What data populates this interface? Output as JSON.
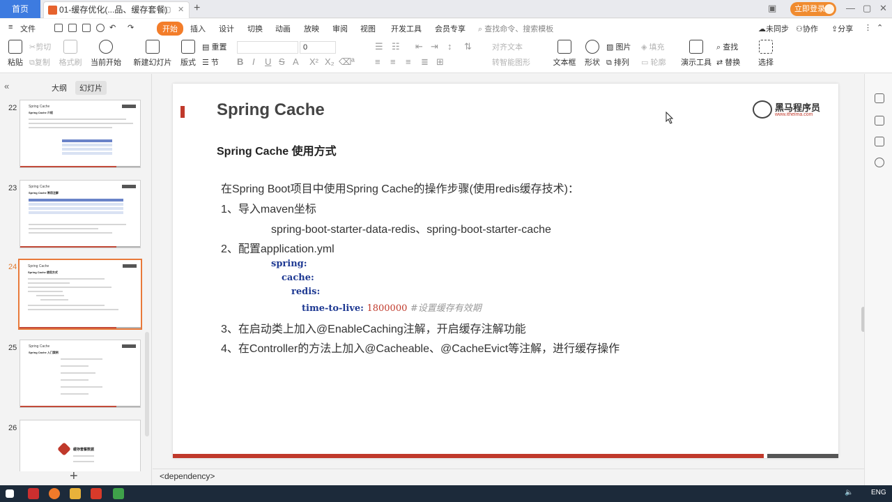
{
  "titlebar": {
    "home_tab": "首页",
    "doc_tab": "01-缓存优化(...品、缓存套餐)",
    "login": "立即登录"
  },
  "menu": {
    "file": "文件",
    "items": [
      "开始",
      "插入",
      "设计",
      "切换",
      "动画",
      "放映",
      "审阅",
      "视图",
      "开发工具",
      "会员专享"
    ],
    "search": "查找命令、搜索模板",
    "right": [
      "未同步",
      "协作",
      "分享"
    ]
  },
  "ribbon": {
    "paste": "粘贴",
    "cut": "剪切",
    "copy": "复制",
    "format_painter": "格式刷",
    "start_current": "当前开始",
    "new_slide": "新建幻灯片",
    "layout": "版式",
    "reset": "重置",
    "section": "节",
    "font_size": "0",
    "text_box": "文本框",
    "shape": "形状",
    "picture": "图片",
    "fill": "填充",
    "arrange": "排列",
    "outline": "轮廓",
    "find": "查找",
    "replace": "替换",
    "present_tools": "演示工具",
    "select": "选择",
    "align_text": "对齐文本",
    "smart_convert": "转智能图形"
  },
  "left_panel": {
    "tabs": [
      "大纲",
      "幻灯片"
    ],
    "slides": [
      {
        "num": "22",
        "title": "Spring Cache",
        "sub": "Spring Cache 介绍"
      },
      {
        "num": "23",
        "title": "Spring Cache",
        "sub": "Spring Cache 常用注解"
      },
      {
        "num": "24",
        "title": "Spring Cache",
        "sub": "Spring Cache 使用方式"
      },
      {
        "num": "25",
        "title": "Spring Cache",
        "sub": "Spring Cache 入门案例"
      },
      {
        "num": "26",
        "title": "",
        "sub": "缓存套餐数据"
      }
    ]
  },
  "slide": {
    "title": "Spring Cache",
    "subtitle": "Spring Cache 使用方式",
    "logo_name": "黑马程序员",
    "logo_url": "www.itheima.com",
    "intro": "在Spring Boot项目中使用Spring Cache的操作步骤(使用redis缓存技术)：",
    "step1": "1、导入maven坐标",
    "step1_detail": "spring-boot-starter-data-redis、spring-boot-starter-cache",
    "step2": "2、配置application.yml",
    "yaml": {
      "l1": "spring:",
      "l2": "cache:",
      "l3": "redis:",
      "l4_key": "time-to-live:",
      "l4_val": "1800000",
      "l4_comment": "#设置缓存有效期"
    },
    "step3": "3、在启动类上加入@EnableCaching注解，开启缓存注解功能",
    "step4": "4、在Controller的方法上加入@Cacheable、@CacheEvict等注解，进行缓存操作"
  },
  "notes": {
    "text": "<dependency>"
  },
  "taskbar": {
    "lang": "ENG"
  },
  "colors": {
    "accent_orange": "#f37d2a",
    "brand_red": "#c0392b",
    "home_blue": "#3d7be0"
  }
}
